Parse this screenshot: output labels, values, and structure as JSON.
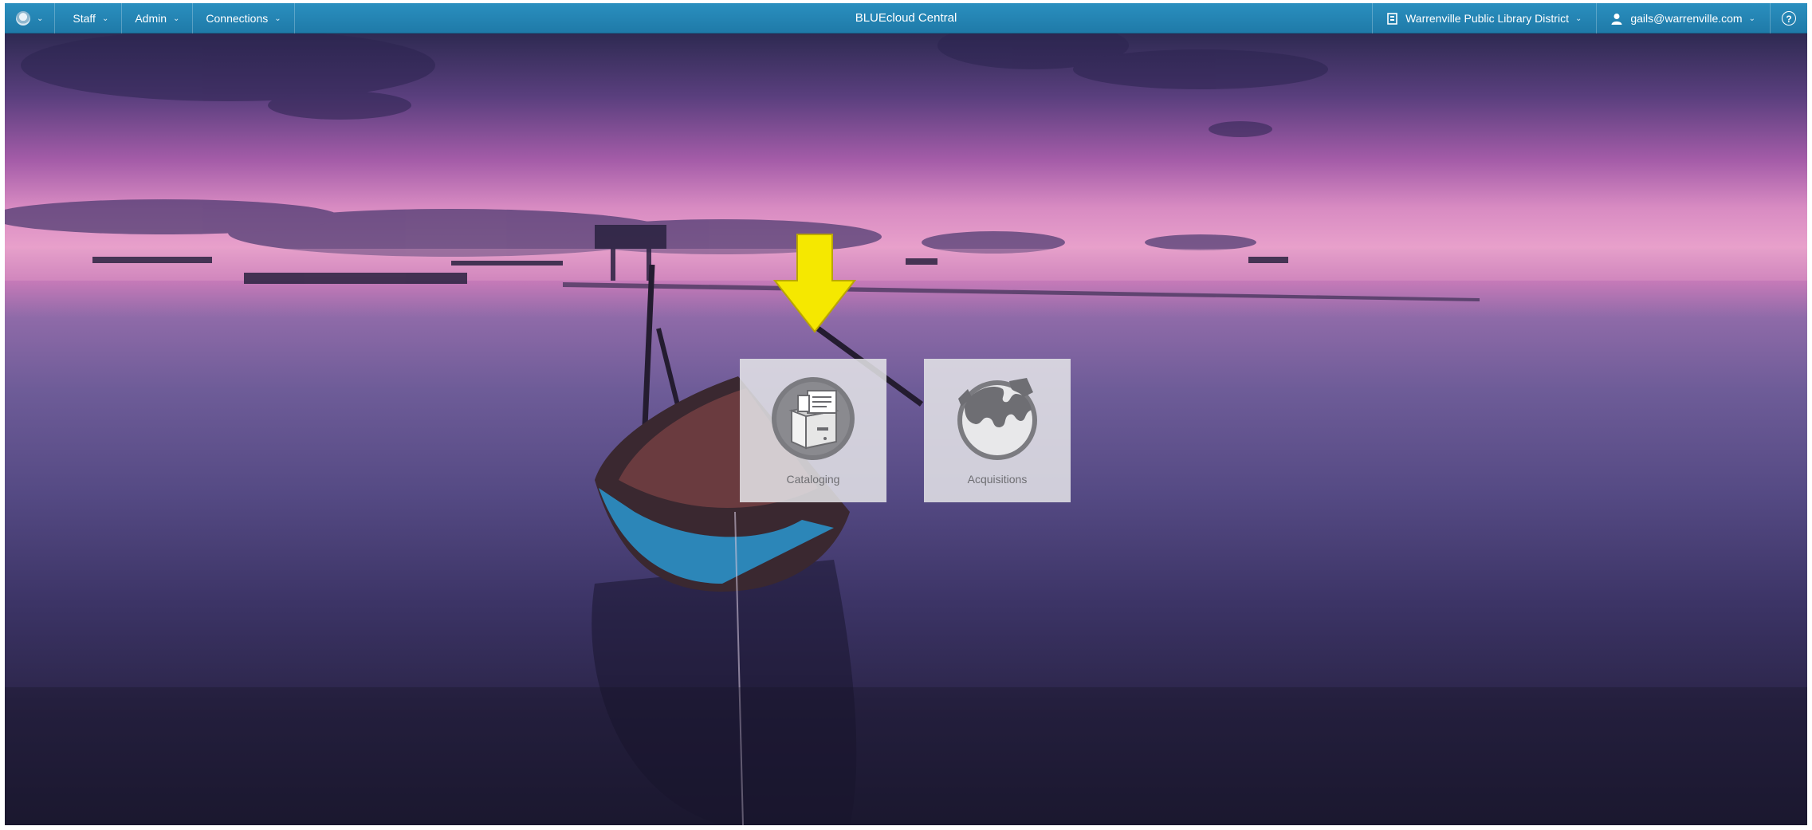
{
  "topbar": {
    "logo_icon": "bluecloud-globe-icon",
    "menus": [
      {
        "label": "Staff"
      },
      {
        "label": "Admin"
      },
      {
        "label": "Connections"
      }
    ],
    "app_title": "BLUEcloud Central",
    "library": {
      "label": "Warrenville Public Library District",
      "icon": "document-icon"
    },
    "user": {
      "label": "gails@warrenville.com",
      "icon": "user-icon"
    },
    "help_icon": "question-mark-icon",
    "caret_glyph": "⌄",
    "colors": {
      "bar": "#2184b5",
      "text": "#ffffff"
    }
  },
  "tiles": [
    {
      "label": "Cataloging",
      "icon": "file-cabinet-icon"
    },
    {
      "label": "Acquisitions",
      "icon": "puzzle-globe-icon"
    }
  ],
  "annotation": {
    "icon": "yellow-down-arrow-icon",
    "color": "#f5e800"
  },
  "background": {
    "description_icon": "sunset-lake-boat-photo"
  }
}
